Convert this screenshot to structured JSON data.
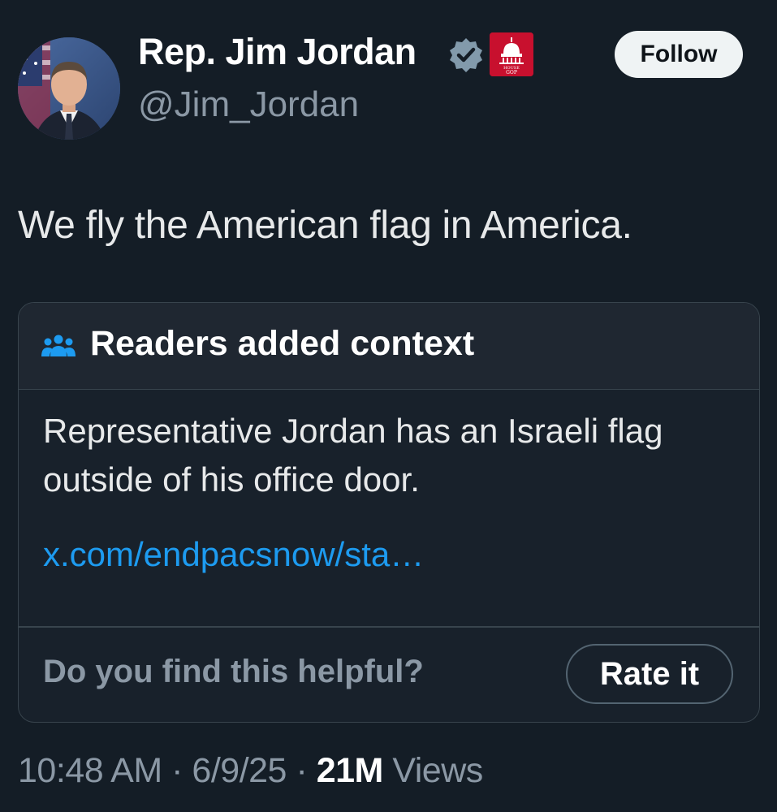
{
  "author": {
    "display_name": "Rep. Jim Jordan",
    "handle": "@Jim_Jordan",
    "verified_icon": "verified-badge-icon",
    "affiliation_badge": "house-gop-badge",
    "affiliation_text_line1": "HOUSE",
    "affiliation_text_line2": "GOP"
  },
  "actions": {
    "follow_label": "Follow"
  },
  "tweet": {
    "text": "We fly the American flag in America."
  },
  "note": {
    "title": "Readers added context",
    "body": "Representative Jordan has an Israeli flag outside of his office door.",
    "link": "x.com/endpacsnow/sta…",
    "helpful_question": "Do you find this helpful?",
    "rate_label": "Rate it"
  },
  "meta": {
    "time": "10:48 AM",
    "separator": "·",
    "date": "6/9/25",
    "views_count": "21M",
    "views_label": "Views"
  },
  "colors": {
    "background": "#141d26",
    "link": "#1d9bf0",
    "muted": "#8b98a5",
    "badge_red": "#c8102e"
  }
}
